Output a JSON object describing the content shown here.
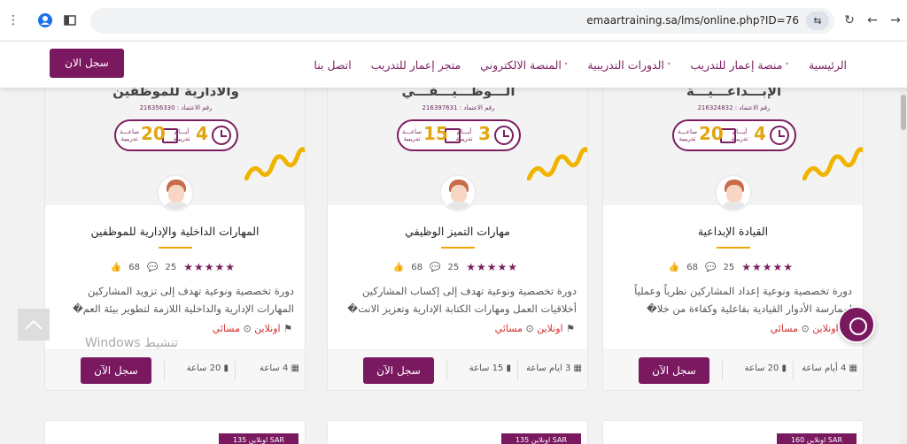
{
  "browser": {
    "url": "emaartraining.sa/lms/online.php?ID=76",
    "icons": [
      "menu-dots-icon",
      "profile-icon",
      "sidebar-icon",
      "bookmark-star-icon",
      "tune-icon",
      "reload-icon",
      "back-icon",
      "forward-icon"
    ]
  },
  "navbar": {
    "links": [
      {
        "label": "الرئيسية",
        "caret": false
      },
      {
        "label": "منصة إعمار للتدريب",
        "caret": true
      },
      {
        "label": "الدورات التدريبية",
        "caret": true
      },
      {
        "label": "المنصة الالكتروني",
        "caret": true
      },
      {
        "label": "متجر إعمار للتدريب",
        "caret": false
      },
      {
        "label": "اتصل بنا",
        "caret": false
      }
    ],
    "register_button": "سجل الان"
  },
  "cards": [
    {
      "image_title": "الإبـــداعـــيـــة",
      "image_license": "رقم الاعتماد : 216324832",
      "days": "4",
      "days_label": "أيـــام تدريبية",
      "hours": "20",
      "hours_label": "ساعـــة تدريبية",
      "title": "القيادة الإبداعية",
      "likes": "68",
      "comments": "25",
      "description": "دورة تخصصية ونوعية إعداد المشاركين نظرياً وعملياً لممارسة الأدوار القيادية بفاعلية وكفاءة من خلا�",
      "location_online": "اونلاين",
      "location_time": "مسائي",
      "button": "سجل الآن",
      "foot_days": "4 أيام ساعة",
      "foot_hours": "20 ساعة",
      "price": "اونلاين 160 SAR"
    },
    {
      "image_title": "الـــوظـــيـــفـــي",
      "image_license": "رقم الاعتماد : 216397631",
      "days": "3",
      "days_label": "أيـــام تدريبية",
      "hours": "15",
      "hours_label": "ساعـــة تدريبية",
      "title": "مهارات التميز الوظيفي",
      "likes": "68",
      "comments": "25",
      "description": "دورة تخصصية ونوعية تهدف إلى إكساب المشاركين أخلاقيات العمل ومهارات الكتابة الإدارية وتعزيز الانت�",
      "location_online": "اونلاين",
      "location_time": "مسائي",
      "button": "سجل الآن",
      "foot_days": "3 ايام ساعة",
      "foot_hours": "15 ساعة",
      "price": "اونلاين 135 SAR"
    },
    {
      "image_title": "والادارية للموظفين",
      "image_license": "رقم الاعتماد : 216356330",
      "days": "4",
      "days_label": "أيـــام تدريبية",
      "hours": "20",
      "hours_label": "ساعـــة تدريبية",
      "title": "المهارات الداخلية والإدارية للموظفين",
      "likes": "68",
      "comments": "25",
      "description": "دورة تخصصية ونوعية تهدف إلى تزويد المشاركين المهارات الإدارية والداخلية اللازمة لتطوير بيئة العم�",
      "location_online": "اونلاين",
      "location_time": "مسائي",
      "button": "سجل الآن",
      "foot_days": "4 ساعة",
      "foot_hours": "20 ساعة",
      "price": "اونلاين 135 SAR"
    }
  ],
  "overlay": {
    "windows_activation": "Windows تنشيط"
  },
  "colors": {
    "brand": "#7a1860",
    "accent": "#f0a500",
    "location_red": "#d32f2f"
  }
}
